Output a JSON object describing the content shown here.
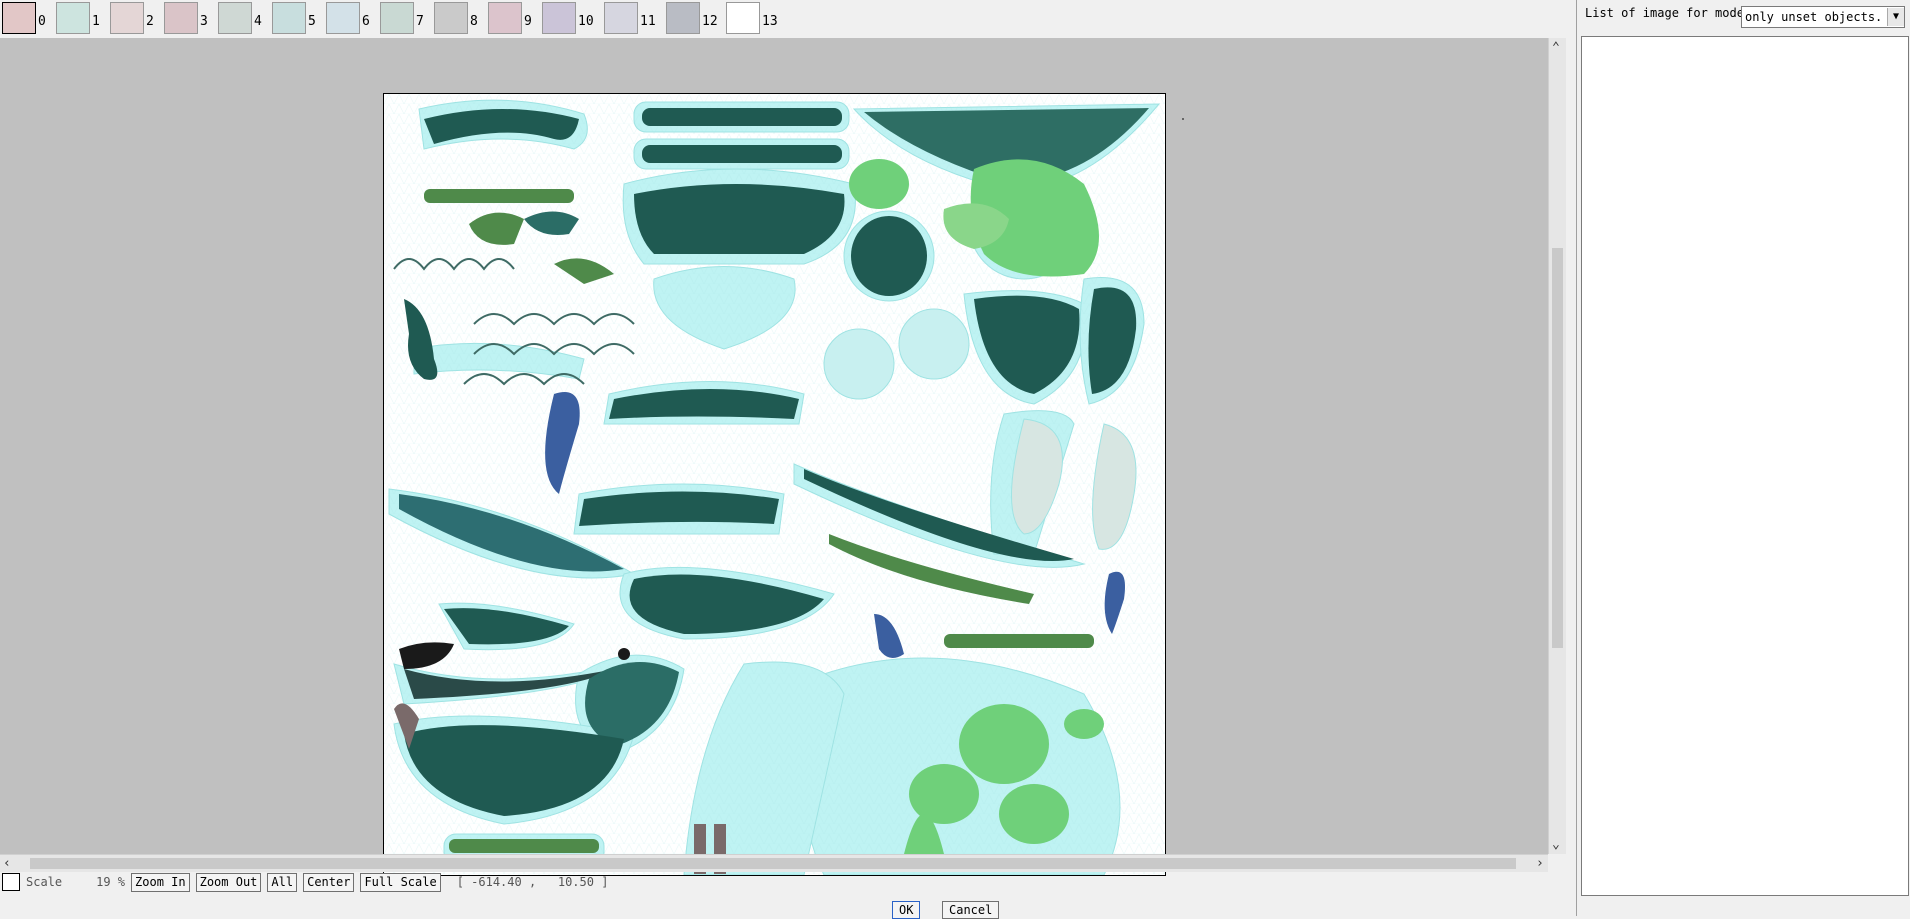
{
  "tabs": [
    {
      "label": "0",
      "selected": true
    },
    {
      "label": "1"
    },
    {
      "label": "2"
    },
    {
      "label": "3"
    },
    {
      "label": "4"
    },
    {
      "label": "5"
    },
    {
      "label": "6"
    },
    {
      "label": "7"
    },
    {
      "label": "8"
    },
    {
      "label": "9"
    },
    {
      "label": "10"
    },
    {
      "label": "11"
    },
    {
      "label": "12"
    },
    {
      "label": "13"
    }
  ],
  "status": {
    "scale_label": "Scale",
    "scale_value": "19 %",
    "zoom_in": "Zoom In",
    "zoom_out": "Zoom Out",
    "all": "All",
    "center": "Center",
    "full_scale": "Full Scale",
    "coords": "[ -614.40 ,   10.50 ]"
  },
  "right_panel": {
    "list_label": "List of image for model.",
    "filter_value": "only unset objects."
  },
  "dialog": {
    "ok": "OK",
    "cancel": "Cancel"
  },
  "colors": {
    "uv_dark": "#1f5a52",
    "uv_mid": "#2f7a6a",
    "uv_light": "#6fd07a",
    "uv_halo": "#bff3f3",
    "canvas_bg": "#c0c0c0"
  }
}
